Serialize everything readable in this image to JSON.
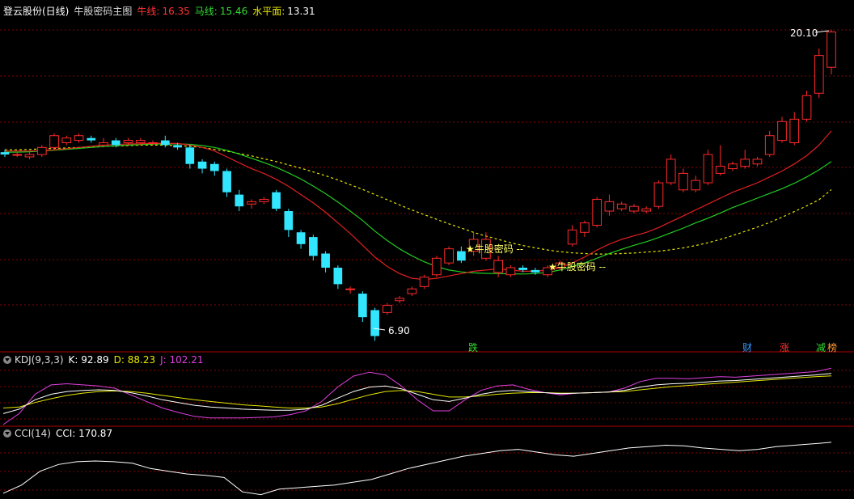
{
  "header": {
    "stock": "登云股份(日线)",
    "indicator_name": "牛股密码主图",
    "line1_label": "牛线:",
    "line1_value": "16.35",
    "line2_label": "马线:",
    "line2_value": "15.46",
    "line3_label": "水平面:",
    "line3_value": "13.31"
  },
  "kdj_header": {
    "name": "KDJ(9,3,3)",
    "k": "K: 92.89",
    "d": "D: 88.23",
    "j": "J: 102.21"
  },
  "cci_header": {
    "name": "CCI(14)",
    "cci": "CCI: 170.87"
  },
  "annotations": {
    "high_label": "20.10",
    "low_label": "6.90",
    "signal1": "★牛股密码 --",
    "signal2": "★牛股密码 --",
    "badge_die": "跌",
    "badge_cai": "财",
    "badge_zhang": "涨",
    "badge_jian": "减",
    "badge_bang": "榜"
  },
  "colors": {
    "up": "#ff2a2a",
    "down": "#33e6ff",
    "ma_red": "#e02020",
    "ma_green": "#22cc22",
    "ma_yellow": "#e6e600",
    "grid": "#8a0000",
    "kdj_k": "#ffffff",
    "kdj_d": "#e6e600",
    "kdj_j": "#e040e0",
    "cci": "#ffffff"
  },
  "chart_data": {
    "type": "candlestick",
    "y_range": [
      6.5,
      20.6
    ],
    "candles": [
      [
        14.9,
        14.8,
        15.0,
        14.7
      ],
      [
        14.8,
        14.8,
        14.9,
        14.7
      ],
      [
        14.7,
        14.8,
        14.9,
        14.6
      ],
      [
        14.8,
        15.1,
        15.2,
        14.7
      ],
      [
        15.1,
        15.6,
        15.7,
        15.0
      ],
      [
        15.3,
        15.5,
        15.6,
        15.2
      ],
      [
        15.4,
        15.6,
        15.7,
        15.3
      ],
      [
        15.5,
        15.4,
        15.6,
        15.3
      ],
      [
        15.2,
        15.3,
        15.5,
        15.1
      ],
      [
        15.4,
        15.2,
        15.5,
        15.1
      ],
      [
        15.3,
        15.4,
        15.5,
        15.2
      ],
      [
        15.3,
        15.4,
        15.5,
        15.2
      ],
      [
        15.3,
        15.3,
        15.4,
        15.2
      ],
      [
        15.4,
        15.2,
        15.6,
        15.1
      ],
      [
        15.2,
        15.1,
        15.3,
        15.0
      ],
      [
        15.1,
        14.4,
        15.2,
        14.2
      ],
      [
        14.5,
        14.2,
        14.6,
        14.0
      ],
      [
        14.4,
        14.1,
        14.5,
        13.9
      ],
      [
        14.1,
        13.2,
        14.2,
        13.0
      ],
      [
        13.1,
        12.6,
        13.3,
        12.4
      ],
      [
        12.7,
        12.8,
        12.9,
        12.5
      ],
      [
        12.8,
        12.9,
        13.0,
        12.7
      ],
      [
        13.2,
        12.5,
        13.3,
        12.4
      ],
      [
        12.4,
        11.6,
        12.5,
        11.3
      ],
      [
        11.5,
        11.0,
        11.6,
        10.8
      ],
      [
        11.3,
        10.5,
        11.4,
        10.3
      ],
      [
        10.6,
        10.0,
        10.7,
        9.8
      ],
      [
        10.0,
        9.3,
        10.1,
        9.1
      ],
      [
        9.1,
        9.1,
        9.2,
        8.9
      ],
      [
        8.9,
        7.9,
        9.0,
        7.7
      ],
      [
        8.2,
        7.1,
        8.3,
        6.9
      ],
      [
        8.1,
        8.4,
        8.5,
        8.0
      ],
      [
        8.6,
        8.7,
        8.8,
        8.5
      ],
      [
        8.9,
        9.1,
        9.2,
        8.8
      ],
      [
        9.2,
        9.6,
        9.7,
        9.1
      ],
      [
        9.7,
        10.4,
        10.5,
        9.6
      ],
      [
        10.2,
        10.8,
        10.9,
        10.1
      ],
      [
        10.7,
        10.3,
        10.9,
        10.2
      ],
      [
        10.7,
        11.2,
        11.5,
        10.5
      ],
      [
        10.4,
        11.2,
        11.5,
        10.3
      ],
      [
        9.8,
        10.3,
        10.5,
        9.6
      ],
      [
        9.7,
        10.0,
        10.1,
        9.6
      ],
      [
        10.0,
        9.9,
        10.1,
        9.8
      ],
      [
        9.9,
        9.8,
        10.0,
        9.7
      ],
      [
        9.7,
        10.0,
        10.1,
        9.6
      ],
      [
        10.0,
        10.2,
        10.3,
        9.9
      ],
      [
        11.0,
        11.6,
        11.8,
        10.9
      ],
      [
        11.5,
        11.9,
        12.0,
        11.3
      ],
      [
        11.8,
        12.9,
        13.0,
        11.7
      ],
      [
        12.4,
        12.8,
        13.1,
        12.2
      ],
      [
        12.5,
        12.7,
        12.8,
        12.4
      ],
      [
        12.4,
        12.6,
        12.7,
        12.3
      ],
      [
        12.4,
        12.5,
        12.6,
        12.3
      ],
      [
        12.6,
        13.6,
        13.7,
        12.5
      ],
      [
        13.6,
        14.6,
        14.8,
        13.5
      ],
      [
        13.3,
        14.0,
        14.2,
        13.2
      ],
      [
        13.3,
        13.7,
        13.9,
        13.2
      ],
      [
        13.6,
        14.8,
        15.0,
        13.5
      ],
      [
        14.0,
        14.3,
        15.2,
        13.9
      ],
      [
        14.2,
        14.4,
        14.5,
        14.1
      ],
      [
        14.3,
        14.6,
        15.0,
        14.2
      ],
      [
        14.4,
        14.6,
        14.7,
        14.3
      ],
      [
        14.8,
        15.6,
        15.8,
        14.7
      ],
      [
        15.4,
        16.2,
        16.4,
        15.3
      ],
      [
        15.3,
        16.3,
        16.6,
        15.2
      ],
      [
        16.3,
        17.3,
        17.5,
        16.2
      ],
      [
        17.4,
        19.0,
        19.3,
        17.2
      ],
      [
        18.5,
        20.0,
        20.1,
        18.2
      ]
    ],
    "ma_red": [
      14.95,
      14.95,
      14.95,
      14.96,
      15.0,
      15.05,
      15.1,
      15.15,
      15.2,
      15.22,
      15.25,
      15.26,
      15.28,
      15.28,
      15.27,
      15.2,
      15.1,
      14.95,
      14.7,
      14.45,
      14.2,
      14.0,
      13.75,
      13.45,
      13.1,
      12.75,
      12.35,
      11.9,
      11.45,
      10.95,
      10.45,
      10.05,
      9.75,
      9.55,
      9.5,
      9.55,
      9.65,
      9.75,
      9.85,
      9.9,
      9.95,
      9.9,
      9.85,
      9.85,
      9.9,
      10.0,
      10.2,
      10.45,
      10.75,
      11.0,
      11.2,
      11.35,
      11.5,
      11.7,
      11.95,
      12.2,
      12.45,
      12.7,
      12.95,
      13.2,
      13.4,
      13.6,
      13.85,
      14.1,
      14.4,
      14.75,
      15.2,
      15.8
    ],
    "ma_green": [
      14.9,
      14.9,
      14.92,
      14.95,
      14.98,
      15.02,
      15.06,
      15.1,
      15.14,
      15.17,
      15.2,
      15.22,
      15.24,
      15.25,
      15.25,
      15.23,
      15.18,
      15.1,
      14.98,
      14.82,
      14.64,
      14.46,
      14.26,
      14.02,
      13.76,
      13.46,
      13.14,
      12.78,
      12.4,
      12.0,
      11.55,
      11.15,
      10.8,
      10.5,
      10.25,
      10.05,
      9.9,
      9.82,
      9.78,
      9.76,
      9.75,
      9.74,
      9.73,
      9.75,
      9.8,
      9.9,
      10.05,
      10.2,
      10.4,
      10.6,
      10.78,
      10.95,
      11.1,
      11.28,
      11.48,
      11.68,
      11.9,
      12.1,
      12.32,
      12.55,
      12.75,
      12.95,
      13.15,
      13.35,
      13.58,
      13.85,
      14.15,
      14.5
    ],
    "ma_yellow": [
      15.0,
      15.0,
      15.02,
      15.04,
      15.06,
      15.08,
      15.1,
      15.12,
      15.14,
      15.16,
      15.18,
      15.2,
      15.2,
      15.2,
      15.18,
      15.15,
      15.1,
      15.02,
      14.94,
      14.84,
      14.74,
      14.62,
      14.5,
      14.36,
      14.22,
      14.06,
      13.9,
      13.72,
      13.52,
      13.32,
      13.1,
      12.88,
      12.66,
      12.45,
      12.25,
      12.05,
      11.86,
      11.68,
      11.5,
      11.34,
      11.2,
      11.06,
      10.94,
      10.84,
      10.75,
      10.68,
      10.63,
      10.6,
      10.58,
      10.58,
      10.6,
      10.62,
      10.66,
      10.7,
      10.76,
      10.84,
      10.94,
      11.06,
      11.2,
      11.36,
      11.54,
      11.72,
      11.92,
      12.14,
      12.38,
      12.62,
      12.88,
      13.31
    ],
    "kdj": {
      "k": [
        20,
        28,
        45,
        55,
        60,
        62,
        63,
        62,
        58,
        52,
        45,
        40,
        35,
        32,
        30,
        28,
        27,
        26,
        26,
        28,
        35,
        48,
        60,
        68,
        70,
        65,
        55,
        45,
        42,
        48,
        55,
        60,
        62,
        60,
        58,
        56,
        57,
        58,
        59,
        62,
        68,
        72,
        74,
        75,
        77,
        79,
        80,
        82,
        84,
        86,
        88,
        90,
        92.89
      ],
      "d": [
        30,
        32,
        40,
        47,
        53,
        57,
        60,
        61,
        60,
        57,
        53,
        49,
        45,
        42,
        39,
        36,
        34,
        32,
        30,
        30,
        32,
        38,
        46,
        54,
        60,
        62,
        60,
        55,
        50,
        50,
        52,
        55,
        57,
        58,
        58,
        57,
        57,
        58,
        59,
        60,
        63,
        66,
        69,
        71,
        73,
        75,
        77,
        79,
        81,
        83,
        85,
        87,
        88.23
      ],
      "j": [
        0,
        20,
        55,
        72,
        74,
        72,
        70,
        66,
        54,
        42,
        30,
        22,
        15,
        12,
        12,
        12,
        13,
        14,
        18,
        25,
        42,
        68,
        88,
        95,
        90,
        70,
        45,
        25,
        25,
        45,
        62,
        70,
        72,
        64,
        58,
        54,
        57,
        58,
        59,
        66,
        78,
        84,
        84,
        83,
        85,
        87,
        86,
        88,
        90,
        92,
        94,
        96,
        102.21
      ]
    },
    "cci": [
      -200,
      -140,
      -40,
      10,
      30,
      35,
      30,
      20,
      -20,
      -40,
      -60,
      -70,
      -85,
      -190,
      -210,
      -170,
      -160,
      -150,
      -140,
      -120,
      -100,
      -60,
      -20,
      10,
      40,
      70,
      90,
      110,
      120,
      100,
      80,
      70,
      90,
      110,
      130,
      140,
      150,
      145,
      130,
      120,
      110,
      120,
      140,
      150,
      160,
      170.87
    ]
  }
}
